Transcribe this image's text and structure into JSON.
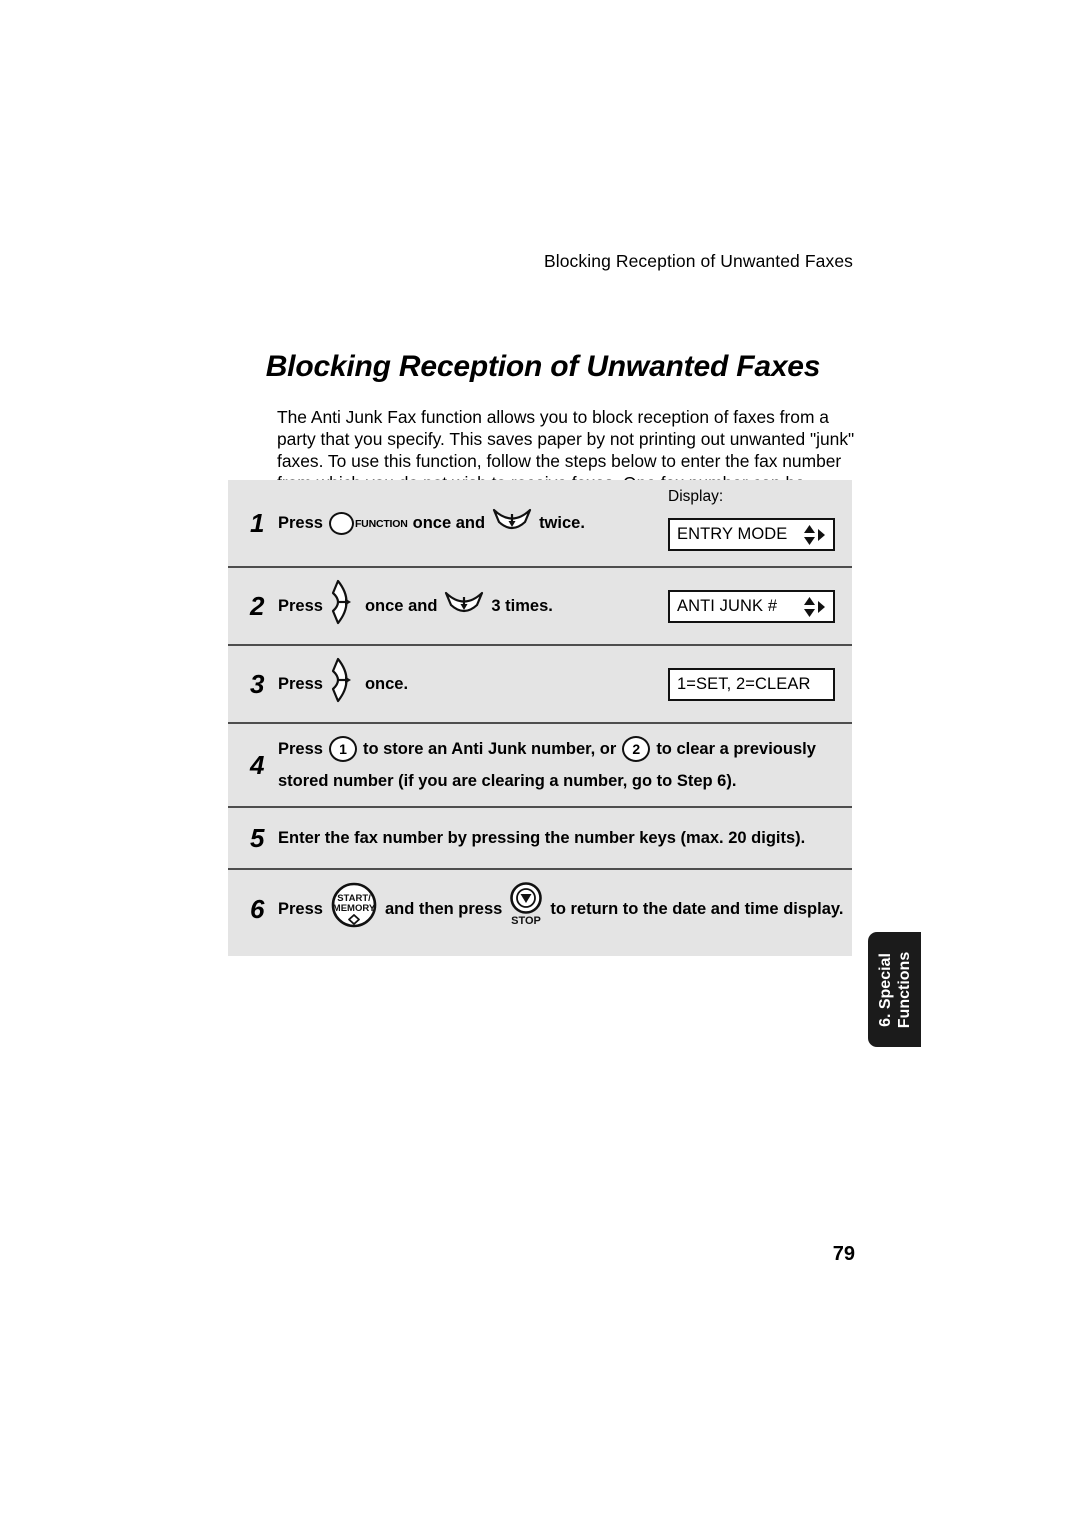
{
  "header": {
    "running_head": "Blocking Reception of Unwanted Faxes"
  },
  "page_title": "Blocking Reception of Unwanted Faxes",
  "intro": "The Anti Junk Fax function allows you to block reception of faxes from a party that you specify. This saves paper by not printing out unwanted \"junk\" faxes. To use this function, follow the steps below to enter the fax number from which you do not wish to receive faxes. One fax number can be entered.",
  "display_label": "Display:",
  "steps": [
    {
      "number": "1",
      "text_1": "Press",
      "function_key_label": "FUNCTION",
      "text_2": "once and",
      "text_3": "twice.",
      "lcd": "ENTRY MODE",
      "lcd_has_arrows": true
    },
    {
      "number": "2",
      "text_1": "Press",
      "text_2": "once and",
      "text_3": "3 times.",
      "lcd": "ANTI JUNK #",
      "lcd_has_arrows": true
    },
    {
      "number": "3",
      "text_1": "Press",
      "text_2": "once.",
      "lcd": "1=SET, 2=CLEAR",
      "lcd_has_arrows": false
    },
    {
      "number": "4",
      "text_1": "Press",
      "key_1": "1",
      "text_2": "to store an Anti Junk number, or",
      "key_2": "2",
      "text_3": "to clear a previously",
      "text_4": "stored number (if you are clearing a number, go to Step 6)."
    },
    {
      "number": "5",
      "text_1": "Enter the fax number by pressing the number keys (max. 20 digits)."
    },
    {
      "number": "6",
      "text_1": "Press",
      "start_key_line1": "START/",
      "start_key_line2": "MEMORY",
      "text_2": "and then press",
      "stop_key_label": "STOP",
      "text_3": "to return to the date and time display."
    }
  ],
  "side_tab": {
    "line1": "6. Special",
    "line2": "Functions"
  },
  "page_number": "79",
  "colors": {
    "panel_background": "#e4e4e4",
    "tab_background": "#1b1b1b",
    "rule": "#4d4d4d",
    "text": "#000000"
  }
}
